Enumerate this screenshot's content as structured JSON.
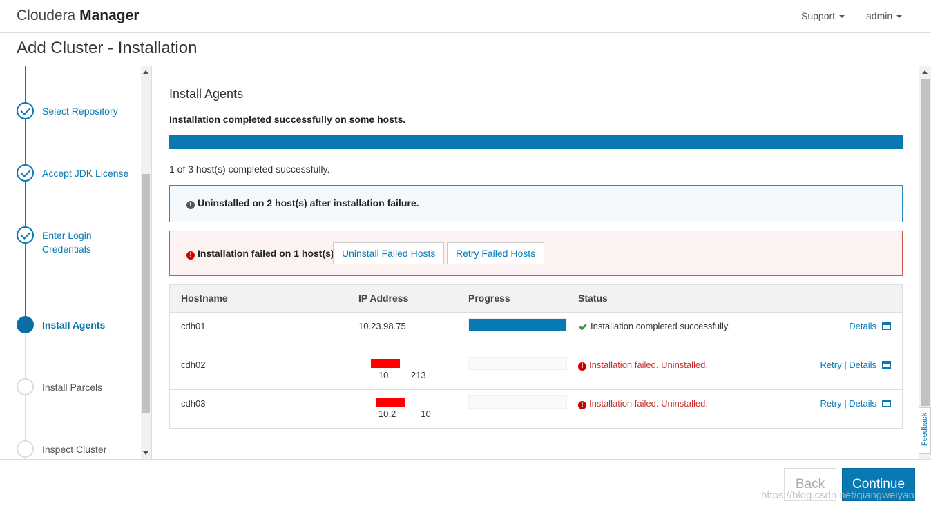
{
  "header": {
    "brand_light": "Cloudera",
    "brand_bold": "Manager",
    "menu_support": "Support",
    "menu_admin": "admin"
  },
  "page_title": "Add Cluster - Installation",
  "wizard": {
    "steps": [
      {
        "label": "Select Repository",
        "state": "done"
      },
      {
        "label": "Accept JDK License",
        "state": "done"
      },
      {
        "label": "Enter Login Credentials",
        "state": "done"
      },
      {
        "label": "Install Agents",
        "state": "active"
      },
      {
        "label": "Install Parcels",
        "state": "todo"
      },
      {
        "label": "Inspect Cluster",
        "state": "todo"
      }
    ]
  },
  "main": {
    "section_title": "Install Agents",
    "status_message": "Installation completed successfully on some hosts.",
    "overall_progress": 1.0,
    "count_message": "1 of 3 host(s) completed successfully.",
    "info_alert": "Uninstalled on 2 host(s) after installation failure.",
    "error_alert": "Installation failed on 1 host(s).",
    "uninstall_button": "Uninstall Failed Hosts",
    "retry_button": "Retry Failed Hosts"
  },
  "table": {
    "headers": [
      "Hostname",
      "IP Address",
      "Progress",
      "Status"
    ],
    "rows": [
      {
        "hostname": "cdh01",
        "ip": "10.23.98.75",
        "progress": 1.0,
        "status": "Installation completed successfully.",
        "status_type": "ok",
        "retry": "",
        "details": "Details"
      },
      {
        "hostname": "cdh02",
        "ip": "10.        213",
        "progress": 0.0,
        "status": "Installation failed. Uninstalled.",
        "status_type": "fail",
        "retry": "Retry",
        "details": "Details"
      },
      {
        "hostname": "cdh03",
        "ip": "10.2          10",
        "progress": 0.0,
        "status": "Installation failed. Uninstalled.",
        "status_type": "fail",
        "retry": "Retry",
        "details": "Details"
      }
    ],
    "link_separator": "|"
  },
  "footer": {
    "back_label": "Back",
    "continue_label": "Continue",
    "watermark": "https://blog.csdn.net/qiangweiyan"
  },
  "feedback_label": "Feedback",
  "colors": {
    "accent": "#0979b4",
    "success": "#3c9a3c",
    "error": "#c9302c",
    "redaction": "#ff0000"
  }
}
